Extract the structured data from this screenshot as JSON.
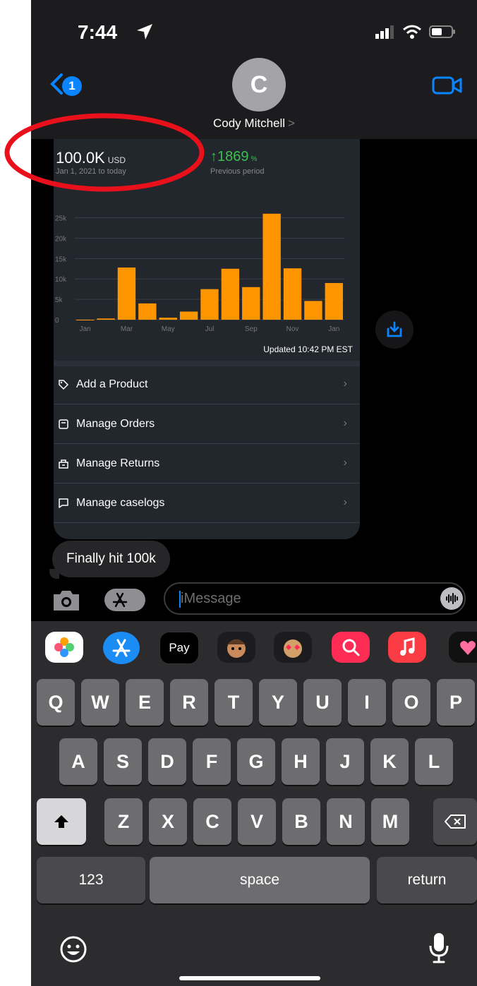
{
  "status_bar": {
    "time": "7:44"
  },
  "header": {
    "back_badge": "1",
    "avatar_initial": "C",
    "contact_name": "Cody Mitchell",
    "contact_chevron": ">"
  },
  "card": {
    "metric_value": "100.0K",
    "metric_unit": "USD",
    "metric_range": "Jan 1, 2021 to today",
    "delta_value": "1869",
    "delta_suffix": "%",
    "delta_label": "Previous period",
    "updated": "Updated 10:42 PM EST",
    "menu": [
      {
        "label": "Add a Product",
        "icon": "tag-icon"
      },
      {
        "label": "Manage Orders",
        "icon": "orders-icon"
      },
      {
        "label": "Manage Returns",
        "icon": "returns-icon"
      },
      {
        "label": "Manage caselogs",
        "icon": "chat-icon"
      }
    ]
  },
  "chart_data": {
    "type": "bar",
    "categories": [
      "Jan",
      "Feb",
      "Mar",
      "Apr",
      "May",
      "Jun",
      "Jul",
      "Aug",
      "Sep",
      "Oct",
      "Nov",
      "Dec",
      "Jan"
    ],
    "x_tick_labels": [
      "Jan",
      "Mar",
      "May",
      "Jul",
      "Sep",
      "Nov",
      "Jan"
    ],
    "values": [
      0,
      300,
      12800,
      4000,
      500,
      2000,
      7500,
      12500,
      8000,
      26000,
      12600,
      4600,
      9000
    ],
    "y_ticks": [
      "0",
      "5k",
      "10k",
      "15k",
      "20k",
      "25k"
    ],
    "ylim": [
      0,
      27000
    ],
    "bar_color": "#ff9500",
    "grid": true
  },
  "message": {
    "text": "Finally hit 100k"
  },
  "compose": {
    "placeholder": "iMessage"
  },
  "app_strip": [
    "photos-icon",
    "app-store-icon",
    "apple-pay-icon",
    "memoji-icon",
    "animoji-icon",
    "web-search-icon",
    "music-icon",
    "stickers-icon"
  ],
  "apple_pay_label": "Pay",
  "keyboard": {
    "row1": [
      "Q",
      "W",
      "E",
      "R",
      "T",
      "Y",
      "U",
      "I",
      "O",
      "P"
    ],
    "row2": [
      "A",
      "S",
      "D",
      "F",
      "G",
      "H",
      "J",
      "K",
      "L"
    ],
    "row3": [
      "Z",
      "X",
      "C",
      "V",
      "B",
      "N",
      "M"
    ],
    "numbers_label": "123",
    "space_label": "space",
    "return_label": "return"
  },
  "colors": {
    "accent": "#0a84ff",
    "bars": "#ff9500",
    "positive": "#3cbf4f"
  }
}
